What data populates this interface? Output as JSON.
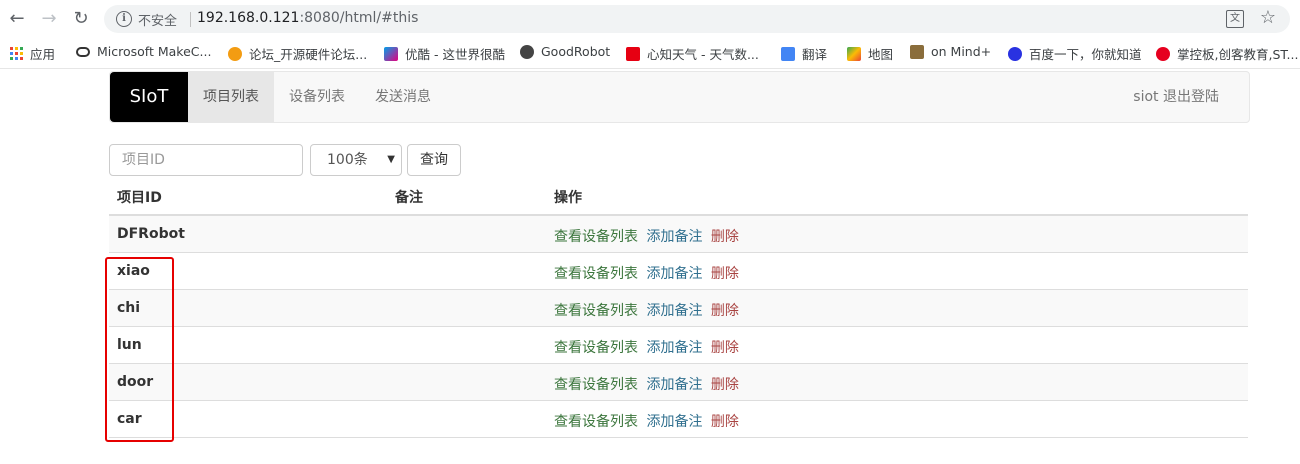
{
  "browser": {
    "insecure_label": "不安全",
    "url_host": "192.168.0.121",
    "url_rest": ":8080/html/#this",
    "bookmarks": [
      {
        "label": "应用",
        "icon": "apps-grid-icon"
      },
      {
        "label": "Microsoft MakeC...",
        "icon": "makecode-icon"
      },
      {
        "label": "论坛_开源硬件论坛...",
        "icon": "dfrobot-fox-icon"
      },
      {
        "label": "优酷 - 这世界很酷",
        "icon": "youku-icon"
      },
      {
        "label": "GoodRobot",
        "icon": "github-icon"
      },
      {
        "label": "心知天气 - 天气数...",
        "icon": "seniverse-icon"
      },
      {
        "label": "翻译",
        "icon": "translate-icon"
      },
      {
        "label": "地图",
        "icon": "maps-icon"
      },
      {
        "label": "on Mind+",
        "icon": "mindplus-icon"
      },
      {
        "label": "百度一下，你就知道",
        "icon": "baidu-paw-icon"
      },
      {
        "label": "掌控板,创客教育,ST...",
        "icon": "mpython-icon"
      }
    ]
  },
  "app": {
    "brand": "SIoT",
    "nav": [
      "项目列表",
      "设备列表",
      "发送消息"
    ],
    "user_logout": "siot 退出登陆",
    "search_placeholder": "项目ID",
    "page_size": "100条",
    "query_button": "查询",
    "table": {
      "headers": [
        "项目ID",
        "备注",
        "操作"
      ],
      "rows": [
        {
          "id": "DFRobot",
          "note": ""
        },
        {
          "id": "xiao",
          "note": ""
        },
        {
          "id": "chi",
          "note": ""
        },
        {
          "id": "lun",
          "note": ""
        },
        {
          "id": "door",
          "note": ""
        },
        {
          "id": "car",
          "note": ""
        }
      ],
      "actions": {
        "view": "查看设备列表",
        "add_note": "添加备注",
        "delete": "删除"
      }
    }
  },
  "colors": {
    "highlight_box": "#e60000",
    "action_view": "#3c763d",
    "action_note": "#31708f",
    "action_delete": "#a94442"
  }
}
